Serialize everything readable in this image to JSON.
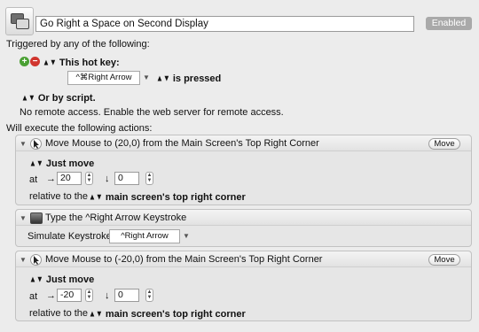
{
  "macro": {
    "name": "Go Right a Space on Second Display",
    "status_label": "Enabled"
  },
  "triggers": {
    "heading": "Triggered by any of the following:",
    "hotkey_label": "This hot key:",
    "hotkey_value": "^⌘Right Arrow",
    "hotkey_state": "is pressed",
    "script_label": "Or by script.",
    "remote_text": "No remote access.  Enable the web server for remote access."
  },
  "actions": {
    "heading": "Will execute the following actions:",
    "move_button_label": "Move",
    "items": [
      {
        "title": "Move Mouse to (20,0) from the Main Screen's Top Right Corner",
        "mode": "Just move",
        "at_label": "at",
        "x_arrow": "→",
        "x": "20",
        "y_arrow": "↓",
        "y": "0",
        "relative_label": "relative to the",
        "relative_value": "main screen's top right corner"
      },
      {
        "title": "Type the ^Right Arrow Keystroke",
        "simulate_label": "Simulate Keystroke:",
        "keystroke": "^Right Arrow"
      },
      {
        "title": "Move Mouse to (-20,0) from the Main Screen's Top Right Corner",
        "mode": "Just move",
        "at_label": "at",
        "x_arrow": "→",
        "x": "-20",
        "y_arrow": "↓",
        "y": "0",
        "relative_label": "relative to the",
        "relative_value": "main screen's top right corner"
      }
    ]
  }
}
